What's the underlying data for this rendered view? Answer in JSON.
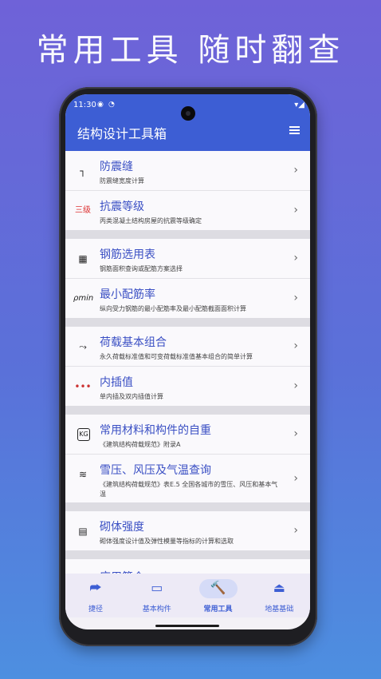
{
  "headline": "常用工具  随时翻查",
  "status": {
    "time": "11:30",
    "icons_left": [
      "notification-icon",
      "wifi-icon"
    ],
    "icons_right": "▾◢"
  },
  "app": {
    "title": "结构设计工具箱",
    "menu_icon": "hamburger-icon",
    "accent": "#3d5ed4"
  },
  "groups": [
    [
      {
        "id": "fzf",
        "icon": "┐",
        "title": "防震缝",
        "subtitle": "防震缝宽度计算"
      },
      {
        "id": "kzdj",
        "icon": "三级",
        "title": "抗震等级",
        "subtitle": "丙类混凝土结构房屋的抗震等级确定"
      }
    ],
    [
      {
        "id": "gjxy",
        "icon": "▦",
        "title": "钢筋选用表",
        "subtitle": "钢筋面积查询或配筋方案选择"
      },
      {
        "id": "zxpjl",
        "icon": "ρmin",
        "title": "最小配筋率",
        "subtitle": "纵向受力钢筋的最小配筋率及最小配筋截面面积计算"
      }
    ],
    [
      {
        "id": "hzjb",
        "icon": "⤳",
        "title": "荷载基本组合",
        "subtitle": "永久荷载标准值和可变荷载标准值基本组合的简单计算"
      },
      {
        "id": "ncz",
        "icon": "•••",
        "title": "内插值",
        "subtitle": "单内插及双内插值计算"
      }
    ],
    [
      {
        "id": "clzz",
        "icon": "KG",
        "title": "常用材料和构件的自重",
        "subtitle": "《建筑结构荷载规范》附录A"
      },
      {
        "id": "xyfy",
        "icon": "≋",
        "title": "雪压、风压及气温查询",
        "subtitle": "《建筑结构荷载规范》表E.5 全国各城市的雪压、风压和基本气温",
        "tall": true
      }
    ],
    [
      {
        "id": "qtqd",
        "icon": "▤",
        "title": "砌体强度",
        "subtitle": "砌体强度设计值及弹性模量等指标的计算和选取"
      }
    ]
  ],
  "partial_title": "应用简介",
  "chevron": "›",
  "nav": [
    {
      "label": "捷径",
      "icon": "⮫",
      "active": false
    },
    {
      "label": "基本构件",
      "icon": "▭",
      "active": false
    },
    {
      "label": "常用工具",
      "icon": "🔨",
      "active": true
    },
    {
      "label": "地基基础",
      "icon": "⏏",
      "active": false
    }
  ]
}
